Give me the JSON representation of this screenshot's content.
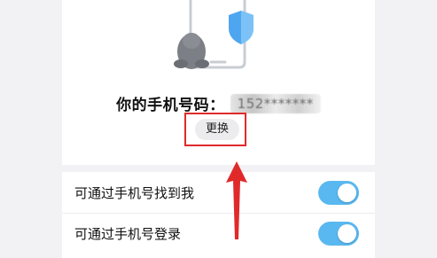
{
  "header": {
    "illustration": "phone-shield-penguin-illustration"
  },
  "phone": {
    "label": "你的手机号码：",
    "masked_number": "152*******"
  },
  "change_button": {
    "label": "更换"
  },
  "settings": {
    "items": [
      {
        "label": "可通过手机号找到我",
        "enabled": true
      },
      {
        "label": "可通过手机号登录",
        "enabled": true
      }
    ]
  },
  "colors": {
    "accent": "#5ab8f0",
    "highlight": "#e02a2a",
    "shield": "#4fa6f0"
  },
  "icons": {
    "arrow": "red-up-arrow-annotation",
    "shield": "shield-icon",
    "penguin": "penguin-mascot-icon"
  }
}
